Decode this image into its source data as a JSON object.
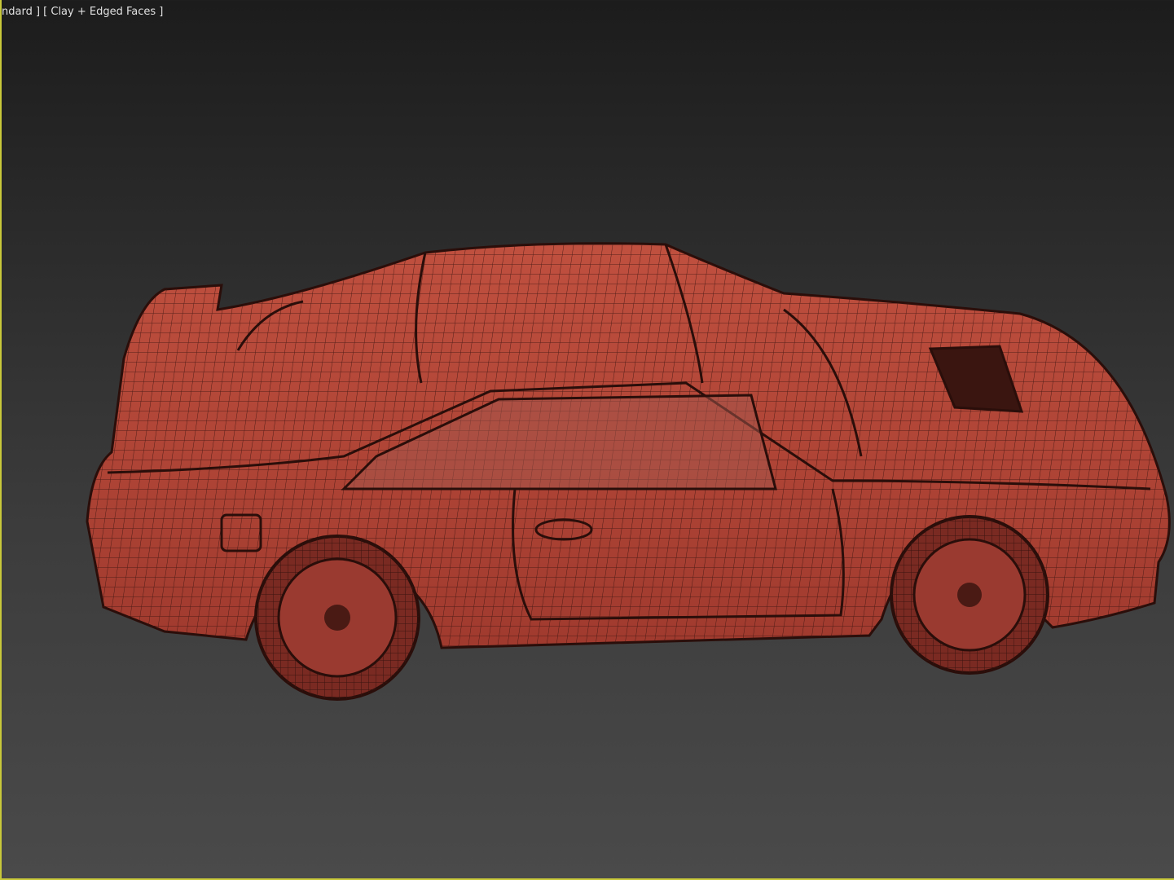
{
  "viewport": {
    "label": "ndard ] [ Clay + Edged Faces ]",
    "active_border_color": "#c8c83a",
    "model_color": "#b5473a",
    "edge_color": "#3a1410"
  }
}
